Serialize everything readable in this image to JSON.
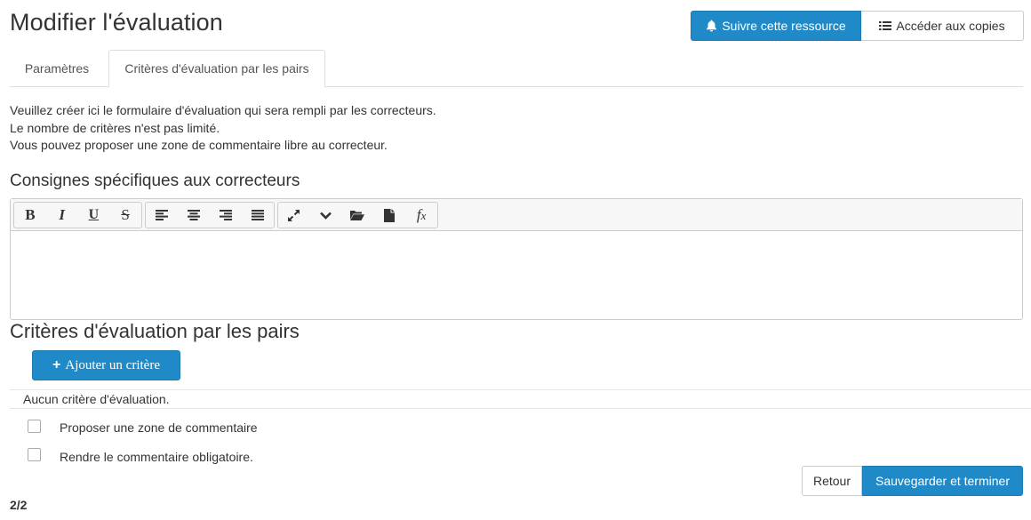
{
  "header": {
    "title": "Modifier l'évaluation",
    "follow_label": "Suivre cette ressource",
    "copies_label": "Accéder aux copies"
  },
  "tabs": [
    {
      "label": "Paramètres",
      "active": false
    },
    {
      "label": "Critères d'évaluation par les pairs",
      "active": true
    }
  ],
  "intro": [
    "Veuillez créer ici le formulaire d'évaluation qui sera rempli par les correcteurs.",
    "Le nombre de critères n'est pas limité.",
    "Vous pouvez proposer une zone de commentaire libre au correcteur."
  ],
  "instructions": {
    "title": "Consignes spécifiques aux correcteurs",
    "content": ""
  },
  "editor_toolbar": {
    "groups": [
      [
        "bold-icon",
        "italic-icon",
        "underline-icon",
        "strikethrough-icon"
      ],
      [
        "align-left-icon",
        "align-center-icon",
        "align-right-icon",
        "align-justify-icon"
      ],
      [
        "fullscreen-icon",
        "chevron-down-icon",
        "folder-open-icon",
        "file-icon",
        "formula-icon"
      ]
    ]
  },
  "criteria": {
    "title": "Critères d'évaluation par les pairs",
    "add_label": "Ajouter un critère",
    "empty_text": "Aucun critère d'évaluation."
  },
  "options": {
    "comment_zone": {
      "label": "Proposer une zone de commentaire",
      "checked": false
    },
    "comment_required": {
      "label": "Rendre le commentaire obligatoire.",
      "checked": false
    }
  },
  "footer": {
    "back_label": "Retour",
    "save_label": "Sauvegarder et terminer",
    "pager": "2/2"
  },
  "colors": {
    "primary": "#1f8ac7",
    "border": "#cccccc"
  }
}
